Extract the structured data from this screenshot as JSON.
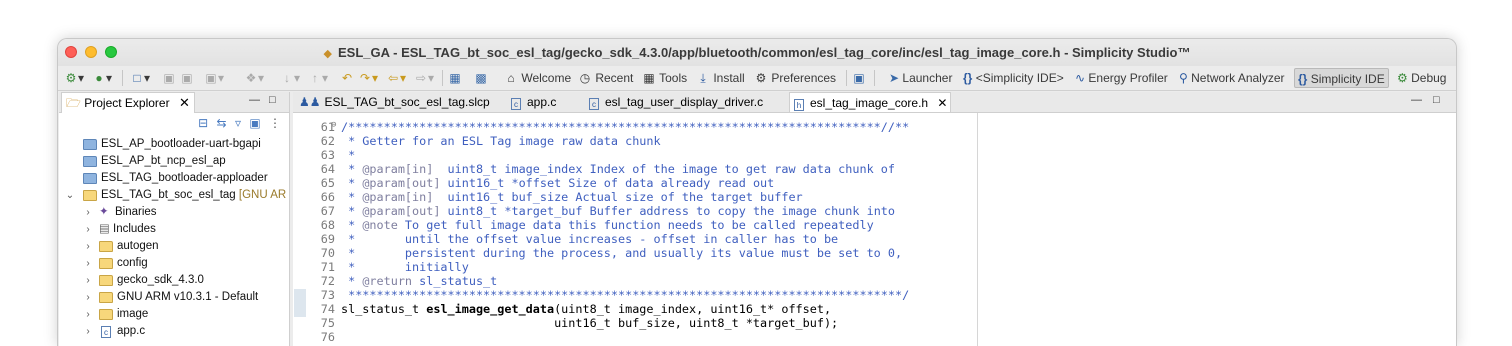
{
  "window": {
    "title": "ESL_GA - ESL_TAG_bt_soc_esl_tag/gecko_sdk_4.3.0/app/bluetooth/common/esl_tag_core/inc/esl_tag_image_core.h - Simplicity Studio™"
  },
  "toolbar": {
    "welcome": "Welcome",
    "recent": "Recent",
    "tools": "Tools",
    "install": "Install",
    "preferences": "Preferences"
  },
  "perspectives": {
    "launcher": "Launcher",
    "simplicity_ide_bracket": "<Simplicity IDE>",
    "energy_profiler": "Energy Profiler",
    "network_analyzer": "Network Analyzer",
    "simplicity_ide": "Simplicity IDE",
    "debug": "Debug"
  },
  "explorer": {
    "tab_label": "Project Explorer",
    "items": [
      {
        "label": "ESL_AP_bootloader-uart-bgapi"
      },
      {
        "label": "ESL_AP_bt_ncp_esl_ap"
      },
      {
        "label": "ESL_TAG_bootloader-apploader"
      },
      {
        "label": "ESL_TAG_bt_soc_esl_tag",
        "decoration": "[GNU AR"
      },
      {
        "label": "Binaries"
      },
      {
        "label": "Includes"
      },
      {
        "label": "autogen"
      },
      {
        "label": "config"
      },
      {
        "label": "gecko_sdk_4.3.0"
      },
      {
        "label": "GNU ARM v10.3.1 - Default"
      },
      {
        "label": "image"
      },
      {
        "label": "app.c"
      }
    ]
  },
  "editor": {
    "tabs": [
      {
        "label": "ESL_TAG_bt_soc_esl_tag.slcp"
      },
      {
        "label": "app.c"
      },
      {
        "label": "esl_tag_user_display_driver.c"
      },
      {
        "label": "esl_tag_image_core.h",
        "active": true
      }
    ],
    "line_numbers": [
      "61",
      "62",
      "63",
      "64",
      "65",
      "66",
      "67",
      "68",
      "69",
      "70",
      "71",
      "72",
      "73",
      "74",
      "75",
      "76"
    ],
    "code": {
      "l61": "/***************************************************************************//**",
      "l62": " * Getter for an ESL Tag image raw data chunk",
      "l63": " *",
      "l64_tag": "@param[in]",
      "l64_text": "  uint8_t image_index Index of the image to get raw data chunk of",
      "l65_tag": "@param[out]",
      "l65_text": " uint16_t *offset Size of data already read out",
      "l66_tag": "@param[in]",
      "l66_text": "  uint16_t buf_size Actual size of the target buffer",
      "l67_tag": "@param[out]",
      "l67_text": " uint8_t *target_buf Buffer address to copy the image chunk into",
      "l68_tag": "@note",
      "l68_text": " To get full image data this function needs to be called repeatedly",
      "l69": " *       until the offset value increases - offset in caller has to be",
      "l70": " *       persistent during the process, and usually its value must be set to 0,",
      "l71": " *       initially",
      "l72_tag": "@return",
      "l72_text": " sl_status_t",
      "l73": " ******************************************************************************/",
      "l74_type": "sl_status_t ",
      "l74_fn": "esl_image_get_data",
      "l74_rest": "(uint8_t image_index, uint16_t* offset,",
      "l75": "                              uint16_t buf_size, uint8_t *target_buf);",
      "l76": ""
    }
  },
  "colors": {
    "comment": "#3f5fbf",
    "javadoc_tag": "#7f7f9f",
    "close_red": "#fe5f57",
    "minimize_yellow": "#febc2e",
    "maximize_green": "#28c840"
  }
}
